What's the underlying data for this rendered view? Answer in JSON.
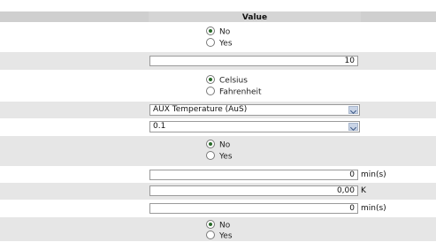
{
  "header": {
    "value_label": "Value"
  },
  "rows": {
    "r1": {
      "options": [
        "No",
        "Yes"
      ],
      "selected": "No"
    },
    "r2": {
      "value": "10"
    },
    "r3": {
      "options": [
        "Celsius",
        "Fahrenheit"
      ],
      "selected": "Celsius"
    },
    "r4": {
      "selected": "AUX Temperature (AuS)",
      "icon": "chevron-down-icon"
    },
    "r5": {
      "selected": "0.1",
      "icon": "chevron-down-icon"
    },
    "r6": {
      "options": [
        "No",
        "Yes"
      ],
      "selected": "No"
    },
    "r7": {
      "value": "0",
      "unit": "min(s)"
    },
    "r8": {
      "value": "0,00",
      "unit": "K"
    },
    "r9": {
      "value": "0",
      "unit": "min(s)"
    },
    "r10": {
      "options": [
        "No",
        "Yes"
      ],
      "selected": "No"
    }
  }
}
